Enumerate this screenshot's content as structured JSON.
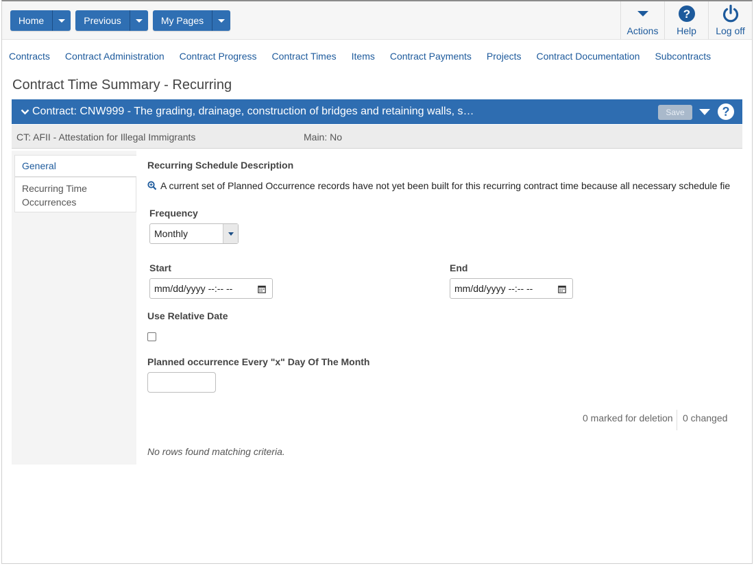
{
  "topbar": {
    "home_label": "Home",
    "previous_label": "Previous",
    "mypages_label": "My Pages",
    "actions_label": "Actions",
    "help_label": "Help",
    "logoff_label": "Log off"
  },
  "nav": [
    "Contracts",
    "Contract Administration",
    "Contract Progress",
    "Contract Times",
    "Items",
    "Contract Payments",
    "Projects",
    "Contract Documentation",
    "Subcontracts"
  ],
  "page_title": "Contract Time Summary - Recurring",
  "contract_bar": {
    "title": "Contract: CNW999 - The grading, drainage, construction of bridges and retaining walls, s…",
    "save_label": "Save",
    "help_glyph": "?"
  },
  "sub_bar": {
    "ct": "CT: AFII - Attestation for Illegal Immigrants",
    "main": "Main: No"
  },
  "side_tabs": {
    "general": "General",
    "recurring": "Recurring Time Occurrences"
  },
  "form": {
    "section_label": "Recurring Schedule Description",
    "message": "A current set of Planned Occurrence records have not yet been built for this recurring contract time because all necessary schedule fie",
    "frequency_label": "Frequency",
    "frequency_value": "Monthly",
    "start_label": "Start",
    "start_placeholder": "mm/dd/yyyy --:-- --",
    "end_label": "End",
    "end_placeholder": "mm/dd/yyyy --:-- --",
    "relative_label": "Use Relative Date",
    "relative_checked": false,
    "every_label": "Planned occurrence Every \"x\" Day Of The Month",
    "every_value": ""
  },
  "grid": {
    "deleted": "0 marked for deletion",
    "changed": "0 changed",
    "empty": "No rows found matching criteria."
  },
  "colors": {
    "primary": "#2f6fb3",
    "link": "#1d5a9c"
  }
}
